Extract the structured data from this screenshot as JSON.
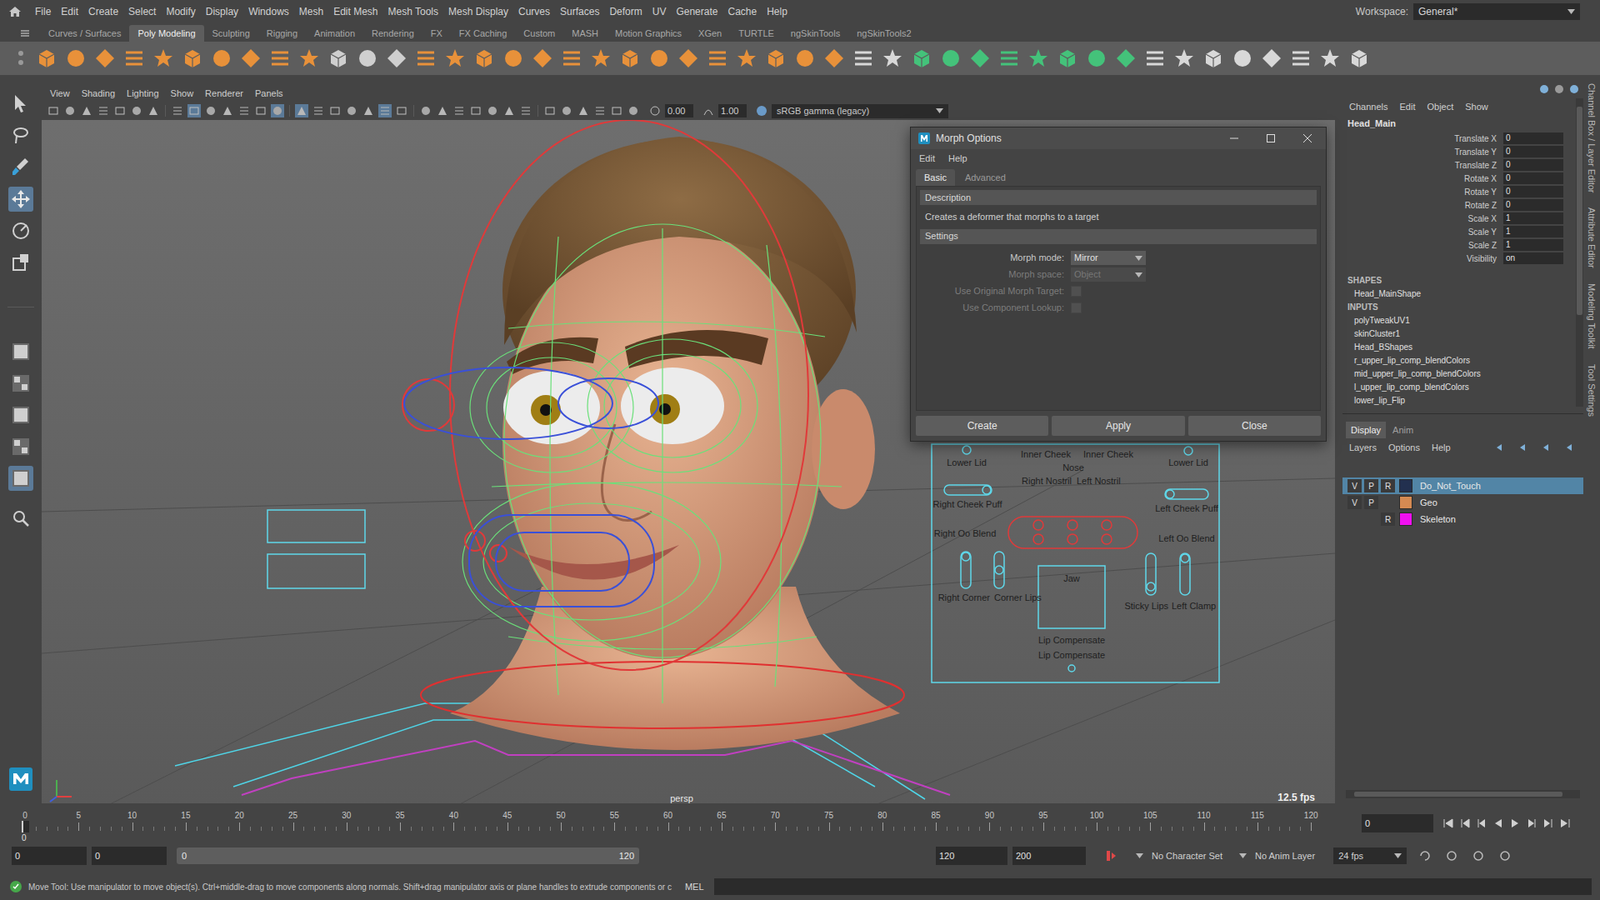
{
  "menubar": {
    "items": [
      "File",
      "Edit",
      "Create",
      "Select",
      "Modify",
      "Display",
      "Windows",
      "Mesh",
      "Edit Mesh",
      "Mesh Tools",
      "Mesh Display",
      "Curves",
      "Surfaces",
      "Deform",
      "UV",
      "Generate",
      "Cache",
      "Help"
    ],
    "workspace_label": "Workspace:",
    "workspace": "General*"
  },
  "shelf": {
    "tabs": [
      {
        "label": "Curves / Surfaces",
        "selected": false
      },
      {
        "label": "Poly Modeling",
        "selected": true
      },
      {
        "label": "Sculpting",
        "selected": false
      },
      {
        "label": "Rigging",
        "selected": false
      },
      {
        "label": "Animation",
        "selected": false
      },
      {
        "label": "Rendering",
        "selected": false
      },
      {
        "label": "FX",
        "selected": false
      },
      {
        "label": "FX Caching",
        "selected": false
      },
      {
        "label": "Custom",
        "selected": false
      },
      {
        "label": "MASH",
        "selected": false
      },
      {
        "label": "Motion Graphics",
        "selected": false
      },
      {
        "label": "XGen",
        "selected": false
      },
      {
        "label": "TURTLE",
        "selected": false
      },
      {
        "label": "ngSkinTools",
        "selected": false
      },
      {
        "label": "ngSkinTools2",
        "selected": false
      }
    ]
  },
  "viewport": {
    "menu": [
      "View",
      "Shading",
      "Lighting",
      "Show",
      "Renderer",
      "Panels"
    ],
    "exposure": "0.00",
    "gamma": "1.00",
    "color_space": "sRGB gamma (legacy)",
    "camera": "persp",
    "fps": "12.5 fps",
    "picker_labels": [
      "Lower Lid",
      "Inner Cheek",
      "Inner Cheek",
      "Lower Lid",
      "Nose",
      "Right Nostril",
      "Left Nostril",
      "Right Cheek Puff",
      "Left Cheek Puff",
      "Right Oo Blend",
      "Left Oo Blend",
      "Jaw",
      "Right Corner",
      "Corner Lips",
      "Sticky Lips",
      "Left Clamp",
      "Lip Compensate",
      "Lip Compensate"
    ]
  },
  "dialog": {
    "title": "Morph Options",
    "menu": [
      "Edit",
      "Help"
    ],
    "tabs": [
      {
        "label": "Basic",
        "selected": true
      },
      {
        "label": "Advanced",
        "selected": false
      }
    ],
    "description_heading": "Description",
    "description": "Creates a deformer that morphs to a target",
    "settings_heading": "Settings",
    "rows": [
      {
        "label": "Morph mode:",
        "kind": "dropdown",
        "value": "Mirror",
        "disabled": false
      },
      {
        "label": "Morph space:",
        "kind": "dropdown",
        "value": "Object",
        "disabled": true
      },
      {
        "label": "Use Original Morph Target:",
        "kind": "checkbox",
        "checked": false,
        "disabled": true
      },
      {
        "label": "Use Component Lookup:",
        "kind": "checkbox",
        "checked": false,
        "disabled": true
      }
    ],
    "buttons": [
      "Create",
      "Apply",
      "Close"
    ]
  },
  "channel_box": {
    "tabs": [
      "Channels",
      "Edit",
      "Object",
      "Show"
    ],
    "node": "Head_Main",
    "attributes": [
      {
        "name": "Translate X",
        "value": "0"
      },
      {
        "name": "Translate Y",
        "value": "0"
      },
      {
        "name": "Translate Z",
        "value": "0"
      },
      {
        "name": "Rotate X",
        "value": "0"
      },
      {
        "name": "Rotate Y",
        "value": "0"
      },
      {
        "name": "Rotate Z",
        "value": "0"
      },
      {
        "name": "Scale X",
        "value": "1"
      },
      {
        "name": "Scale Y",
        "value": "1"
      },
      {
        "name": "Scale Z",
        "value": "1"
      },
      {
        "name": "Visibility",
        "value": "on"
      }
    ],
    "shapes_heading": "SHAPES",
    "shapes": [
      "Head_MainShape"
    ],
    "inputs_heading": "INPUTS",
    "inputs": [
      "polyTweakUV1",
      "skinCluster1",
      "Head_BShapes",
      "r_upper_lip_comp_blendColors",
      "mid_upper_lip_comp_blendColors",
      "l_upper_lip_comp_blendColors",
      "lower_lip_Flip"
    ]
  },
  "layer_editor": {
    "tabs": [
      {
        "label": "Display",
        "selected": true
      },
      {
        "label": "Anim",
        "selected": false
      }
    ],
    "menu": [
      "Layers",
      "Options",
      "Help"
    ],
    "layers": [
      {
        "name": "Do_Not_Touch",
        "cells": [
          "V",
          "P",
          "R"
        ],
        "color": "#22304f",
        "selected": true
      },
      {
        "name": "Geo",
        "cells": [
          "V",
          "P",
          ""
        ],
        "color": "#d58a52",
        "selected": false
      },
      {
        "name": "Skeleton",
        "cells": [
          "",
          "",
          "R"
        ],
        "color": "#f010f0",
        "selected": false
      }
    ]
  },
  "side_tabs": [
    "Channel Box / Layer Editor",
    "Attribute Editor",
    "Modeling Toolkit",
    "Tool Settings"
  ],
  "timeline": {
    "ticks": [
      "0",
      "5",
      "10",
      "15",
      "20",
      "25",
      "30",
      "35",
      "40",
      "45",
      "50",
      "55",
      "60",
      "65",
      "70",
      "75",
      "80",
      "85",
      "90",
      "95",
      "100",
      "105",
      "110",
      "115",
      "120"
    ],
    "current_frame": "0",
    "frame_field": "0"
  },
  "range": {
    "fields_left": [
      "0",
      "0"
    ],
    "range_start": "0",
    "range_end": "120",
    "fields_right": [
      "120",
      "200"
    ],
    "character_set": "No Character Set",
    "anim_layer": "No Anim Layer",
    "fps": "24 fps"
  },
  "help_line": {
    "text": "Move Tool: Use manipulator to move object(s). Ctrl+middle-drag to move components along normals. Shift+drag manipulator axis or plane handles to extrude components or c",
    "language": "MEL"
  }
}
